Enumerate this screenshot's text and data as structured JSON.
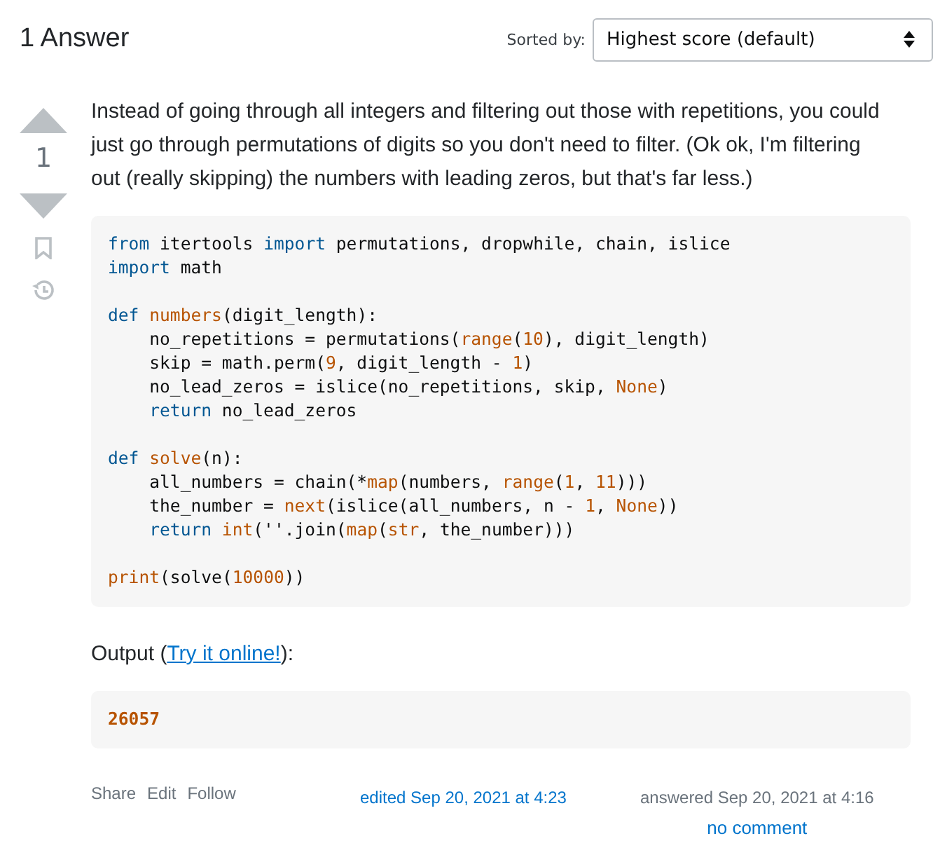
{
  "header": {
    "title": "1 Answer",
    "sort_label": "Sorted by:",
    "sort_value": "Highest score (default)"
  },
  "answer": {
    "score": "1",
    "body": "Instead of going through all integers and filtering out those with repetitions, you could just go through permutations of digits so you don't need to filter. (Ok ok, I'm filtering out (really skipping) the numbers with leading zeros, but that's far less.)",
    "code": [
      [
        {
          "indent": false,
          "tokens": [
            {
              "kind": "keyword",
              "text": "from"
            },
            {
              "kind": "plain",
              "sp": true,
              "text": "itertools"
            },
            {
              "kind": "keyword",
              "sp": true,
              "text": "import"
            },
            {
              "kind": "plain",
              "sp": true,
              "text": "permutations, dropwhile, chain, islice"
            }
          ]
        },
        {
          "indent": false,
          "tokens": [
            {
              "kind": "keyword",
              "text": "import"
            },
            {
              "kind": "plain",
              "sp": true,
              "text": "math"
            }
          ]
        }
      ],
      [
        {
          "indent": false,
          "tokens": [
            {
              "kind": "keyword",
              "text": "def"
            },
            {
              "kind": "literal",
              "sp": true,
              "text": "numbers"
            },
            {
              "kind": "plain",
              "text": "(digit_length):"
            }
          ]
        },
        {
          "indent": true,
          "tokens": [
            {
              "kind": "plain",
              "text": "no_repetitions = permutations("
            },
            {
              "kind": "literal",
              "text": "range"
            },
            {
              "kind": "plain",
              "text": "("
            },
            {
              "kind": "literal",
              "text": "10"
            },
            {
              "kind": "plain",
              "text": "), digit_length)"
            }
          ]
        },
        {
          "indent": true,
          "tokens": [
            {
              "kind": "plain",
              "text": "skip = math.perm("
            },
            {
              "kind": "literal",
              "text": "9"
            },
            {
              "kind": "plain",
              "text": ", digit_length -"
            },
            {
              "kind": "literal",
              "sp": true,
              "text": "1"
            },
            {
              "kind": "plain",
              "text": ")"
            }
          ]
        },
        {
          "indent": true,
          "tokens": [
            {
              "kind": "plain",
              "text": "no_lead_zeros = islice(no_repetitions, skip,"
            },
            {
              "kind": "literal",
              "sp": true,
              "text": "None"
            },
            {
              "kind": "plain",
              "text": ")"
            }
          ]
        },
        {
          "indent": true,
          "tokens": [
            {
              "kind": "keyword",
              "text": "return"
            },
            {
              "kind": "plain",
              "sp": true,
              "text": "no_lead_zeros"
            }
          ]
        }
      ],
      [
        {
          "indent": false,
          "tokens": [
            {
              "kind": "keyword",
              "text": "def"
            },
            {
              "kind": "literal",
              "sp": true,
              "text": "solve"
            },
            {
              "kind": "plain",
              "text": "(n):"
            }
          ]
        },
        {
          "indent": true,
          "tokens": [
            {
              "kind": "plain",
              "text": "all_numbers = chain(*"
            },
            {
              "kind": "literal",
              "text": "map"
            },
            {
              "kind": "plain",
              "text": "(numbers,"
            },
            {
              "kind": "literal",
              "sp": true,
              "text": "range"
            },
            {
              "kind": "plain",
              "text": "("
            },
            {
              "kind": "literal",
              "text": "1"
            },
            {
              "kind": "plain",
              "text": ","
            },
            {
              "kind": "literal",
              "sp": true,
              "text": "11"
            },
            {
              "kind": "plain",
              "text": ")))"
            }
          ]
        },
        {
          "indent": true,
          "tokens": [
            {
              "kind": "plain",
              "text": "the_number ="
            },
            {
              "kind": "literal",
              "sp": true,
              "text": "next"
            },
            {
              "kind": "plain",
              "text": "(islice(all_numbers, n -"
            },
            {
              "kind": "literal",
              "sp": true,
              "text": "1"
            },
            {
              "kind": "plain",
              "text": ","
            },
            {
              "kind": "literal",
              "sp": true,
              "text": "None"
            },
            {
              "kind": "plain",
              "text": "))"
            }
          ]
        },
        {
          "indent": true,
          "tokens": [
            {
              "kind": "keyword",
              "text": "return"
            },
            {
              "kind": "literal",
              "sp": true,
              "text": "int"
            },
            {
              "kind": "plain",
              "text": "(''.join("
            },
            {
              "kind": "literal",
              "text": "map"
            },
            {
              "kind": "plain",
              "text": "("
            },
            {
              "kind": "literal",
              "text": "str"
            },
            {
              "kind": "plain",
              "text": ", the_number)))"
            }
          ]
        }
      ],
      [
        {
          "indent": false,
          "tokens": [
            {
              "kind": "literal",
              "text": "print"
            },
            {
              "kind": "plain",
              "text": "(solve("
            },
            {
              "kind": "literal",
              "text": "10000"
            },
            {
              "kind": "plain",
              "text": "))"
            }
          ]
        }
      ]
    ],
    "output_before": "Output (",
    "output_link": "Try it online!",
    "output_after": "):",
    "output": "26057",
    "actions": [
      "Share",
      "Edit",
      "Follow"
    ],
    "edited": "edited Sep 20, 2021 at 4:23",
    "answered": "answered Sep 20, 2021 at 4:16",
    "author": "no comment"
  }
}
